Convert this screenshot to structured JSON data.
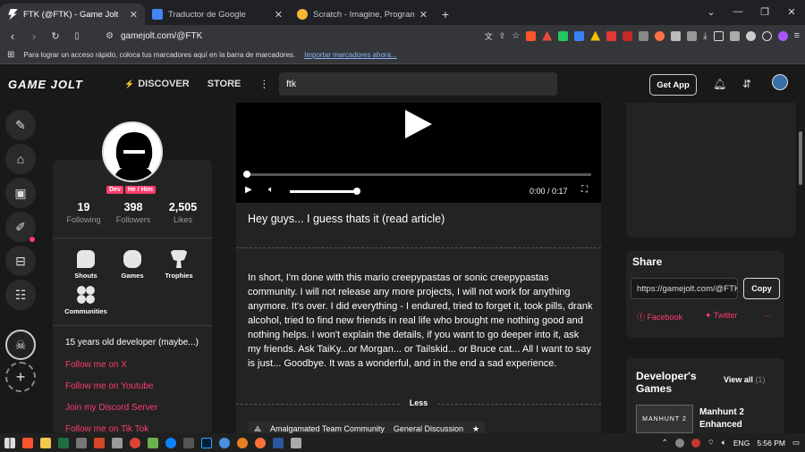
{
  "browser": {
    "tabs": [
      {
        "title": "FTK (@FTK) - Game Jolt",
        "color": "#1e1e1e"
      },
      {
        "title": "Traductor de Google",
        "color": "#4285f4"
      },
      {
        "title": "Scratch - Imagine, Program, Share",
        "color": "#f7b733"
      }
    ],
    "new_tab": "+",
    "url": "gamejolt.com/@FTK",
    "bookmarks_text": "Para lograr un acceso rápido, coloca tus marcadores aquí en la barra de marcadores.",
    "bookmarks_link": "Importar marcadores ahora..."
  },
  "header": {
    "logo": "GAME JOLT",
    "discover": "DISCOVER",
    "store": "STORE",
    "search_value": "ftk",
    "get_app": "Get App"
  },
  "profile": {
    "badges": [
      "Dev",
      "He / Him"
    ],
    "stats": [
      {
        "value": "19",
        "label": "Following"
      },
      {
        "value": "398",
        "label": "Followers"
      },
      {
        "value": "2,505",
        "label": "Likes"
      }
    ],
    "quick_links": [
      "Shouts",
      "Games",
      "Trophies",
      "Communities"
    ],
    "bio": "15 years old developer (maybe...)",
    "links": [
      "Follow me on X",
      "Follow me on Youtube",
      "Join my Discord Server",
      "Follow me on Tik Tok"
    ]
  },
  "post": {
    "video_time": "0:00 / 0:17",
    "video_progress": 0,
    "title": "Hey guys... I guess thats it (read article)",
    "body": "In short, I'm done with this mario creepypastas or sonic creepypastas community. I will not release any more projects, I will not work for anything anymore. It's over. I did everything - I endured, tried to forget it, took pills, drank alcohol, tried to find new friends in real life who brought me nothing good and nothing helps. I won't explain the details, if you want to go deeper into it, ask my friends. Ask TaiKy...or Morgan... or Tailskid... or Bruce cat... All I want to say is just... Goodbye. It was a wonderful, and in the end a sad experience.",
    "less": "Less",
    "community": "Amalgamated Team Community",
    "channel": "General Discussion"
  },
  "share": {
    "title": "Share",
    "url": "https://gamejolt.com/@FTK",
    "copy": "Copy",
    "facebook": "Facebook",
    "twitter": "Twitter",
    "more": "···"
  },
  "dev_games": {
    "title": "Developer's Games",
    "view_all": "View all",
    "count": "(1)",
    "game_name": "Manhunt 2 Enhanced",
    "thumb_text": "MANHUNT 2"
  },
  "taskbar": {
    "lang": "ENG",
    "time": "5:56 PM"
  },
  "colors": {
    "accent": "#ff3c6e",
    "bg": "#191919",
    "panel": "#232323"
  }
}
